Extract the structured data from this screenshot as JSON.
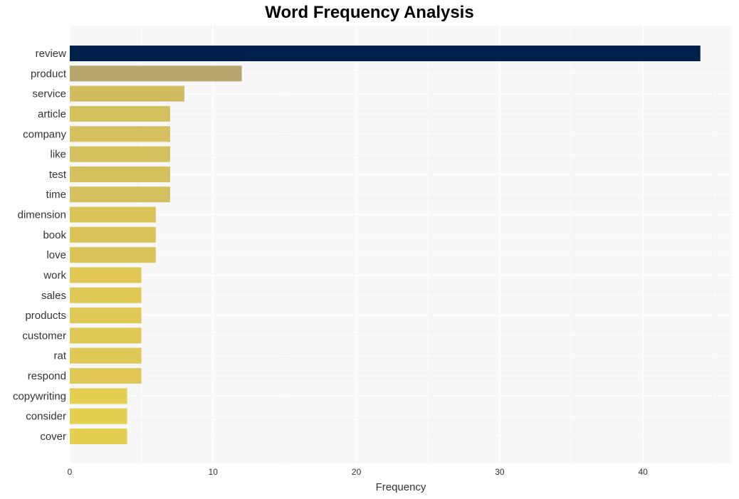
{
  "chart_data": {
    "type": "bar",
    "orientation": "horizontal",
    "title": "Word Frequency Analysis",
    "xlabel": "Frequency",
    "ylabel": "",
    "xlim": [
      0,
      46.2
    ],
    "xticks": [
      0,
      10,
      20,
      30,
      40
    ],
    "grid": true,
    "legend": "none",
    "categories": [
      "review",
      "product",
      "service",
      "article",
      "company",
      "like",
      "test",
      "time",
      "dimension",
      "book",
      "love",
      "work",
      "sales",
      "products",
      "customer",
      "rat",
      "respond",
      "copywriting",
      "consider",
      "cover"
    ],
    "values": [
      44,
      12,
      8,
      7,
      7,
      7,
      7,
      7,
      6,
      6,
      6,
      5,
      5,
      5,
      5,
      5,
      5,
      4,
      4,
      4
    ],
    "colors": [
      "#00204c",
      "#b7a66e",
      "#d1bc5e",
      "#d4c05d",
      "#d4c05d",
      "#d4c05d",
      "#d4c05d",
      "#d4c05d",
      "#dac45a",
      "#dac45a",
      "#dac45a",
      "#dfc856",
      "#dfc856",
      "#dfc856",
      "#dfc856",
      "#dfc856",
      "#dfc856",
      "#e4cf51",
      "#e4cf51",
      "#e4cf51"
    ]
  }
}
